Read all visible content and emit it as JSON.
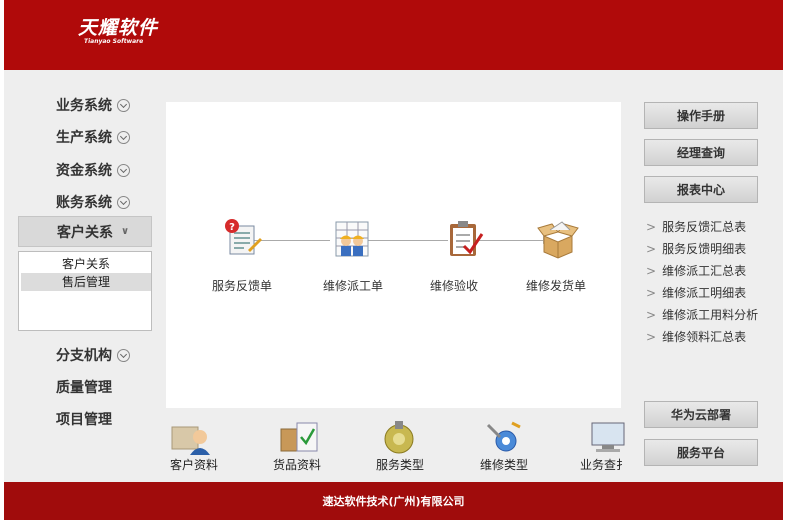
{
  "header": {
    "logo_main": "天耀软件",
    "logo_sub": "Tianyao Software"
  },
  "left_menu": {
    "items_top": [
      "业务系统",
      "生产系统",
      "资金系统",
      "账务系统"
    ],
    "active": "客户关系",
    "submenu": [
      "客户关系",
      "售后管理"
    ],
    "items_bottom": [
      "分支机构",
      "质量管理",
      "项目管理"
    ]
  },
  "flow": {
    "steps": [
      "服务反馈单",
      "维修派工单",
      "维修验收",
      "维修发货单"
    ]
  },
  "bottom_icons": [
    "客户资料",
    "货品资料",
    "服务类型",
    "维修类型",
    "业务查扌"
  ],
  "right_panel": {
    "buttons_top": [
      "操作手册",
      "经理查询",
      "报表中心"
    ],
    "links": [
      "服务反馈汇总表",
      "服务反馈明细表",
      "维修派工汇总表",
      "维修派工明细表",
      "维修派工用料分析",
      "维修领料汇总表"
    ],
    "buttons_bottom": [
      "华为云部署",
      "服务平台"
    ]
  },
  "footer": {
    "text": "速达软件技术(广州)有限公司"
  },
  "colors": {
    "brand_red": "#b00a0a",
    "footer_red": "#a00c0c",
    "panel_bg": "#eeeeee"
  }
}
